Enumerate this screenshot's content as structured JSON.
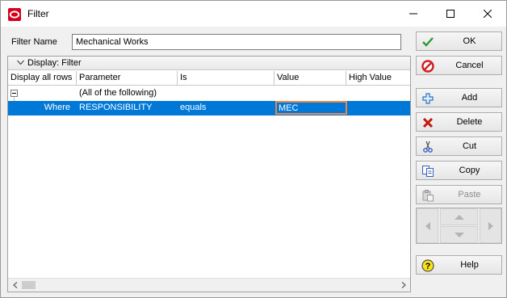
{
  "window": {
    "title": "Filter"
  },
  "filter_name": {
    "label": "Filter Name",
    "value": "Mechanical Works"
  },
  "display_bar": {
    "label": "Display: Filter"
  },
  "columns": [
    "Display all rows",
    "Parameter",
    "Is",
    "Value",
    "High Value"
  ],
  "group_row": {
    "text": "(All of the following)"
  },
  "filter_row": {
    "where": "Where",
    "parameter": "RESPONSIBILITY",
    "is": "equals",
    "value": "MEC",
    "high_value": ""
  },
  "buttons": {
    "ok": "OK",
    "cancel": "Cancel",
    "add": "Add",
    "delete": "Delete",
    "cut": "Cut",
    "copy": "Copy",
    "paste": "Paste",
    "help": "Help"
  },
  "colors": {
    "selection": "#0078d7",
    "edit_border": "#e8884a",
    "brand_red": "#d6001c"
  }
}
